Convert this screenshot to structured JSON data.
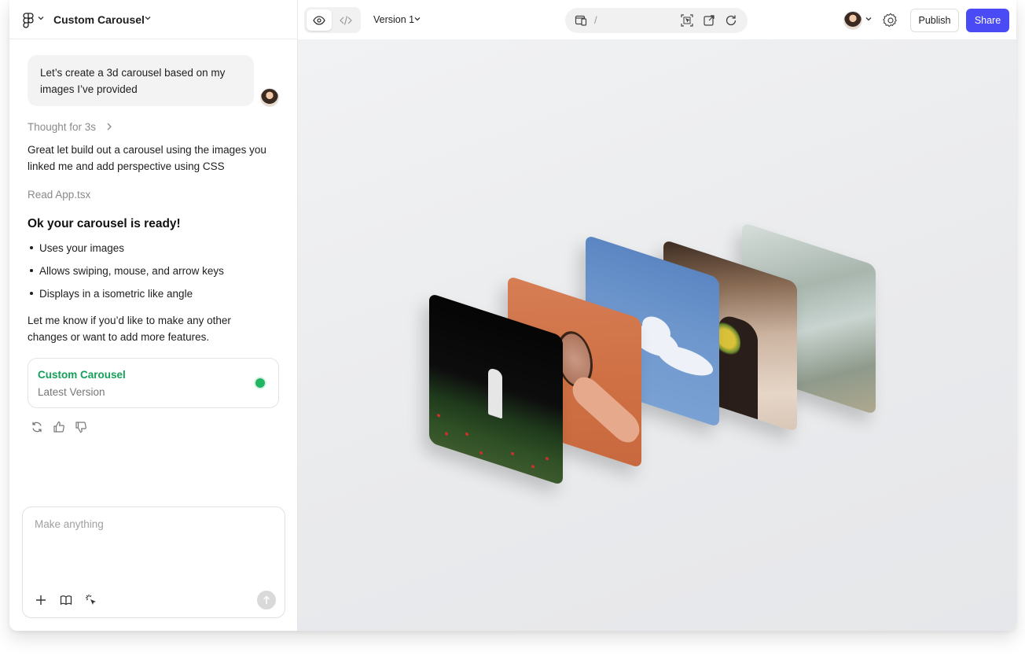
{
  "app": {
    "project_title": "Custom Carousel",
    "icons": {
      "logo": "figma-logo-icon",
      "chevron": "chevron-down-icon"
    }
  },
  "chat": {
    "user_message": "Let’s create a 3d carousel based on my images I’ve provided",
    "thought": "Thought for 3s",
    "reply_intro": "Great let build out a carousel using the images you linked me and add perspective using CSS",
    "read_file": "Read App.tsx",
    "ready_heading": "Ok your carousel is ready!",
    "bullets": [
      "Uses your images",
      "Allows swiping, mouse, and arrow keys",
      "Displays in a isometric like angle"
    ],
    "closing": "Let me know if you’d like to make any other changes or want to add more features.",
    "version_card": {
      "title": "Custom Carousel",
      "subtitle": "Latest Version",
      "status_color": "#1fb562"
    }
  },
  "composer": {
    "placeholder": "Make anything",
    "tools": [
      "plus-icon",
      "book-icon",
      "magic-cursor-icon"
    ]
  },
  "toolbar": {
    "version_label": "Version 1",
    "url_path": "/",
    "publish_label": "Publish",
    "share_label": "Share",
    "accent_color": "#4b4bf5"
  },
  "carousel": {
    "cards": [
      "night-field-photo",
      "orange-hand-photo",
      "blue-sky-cloud-photo",
      "flowers-portrait-photo",
      "water-sparkle-photo"
    ]
  }
}
